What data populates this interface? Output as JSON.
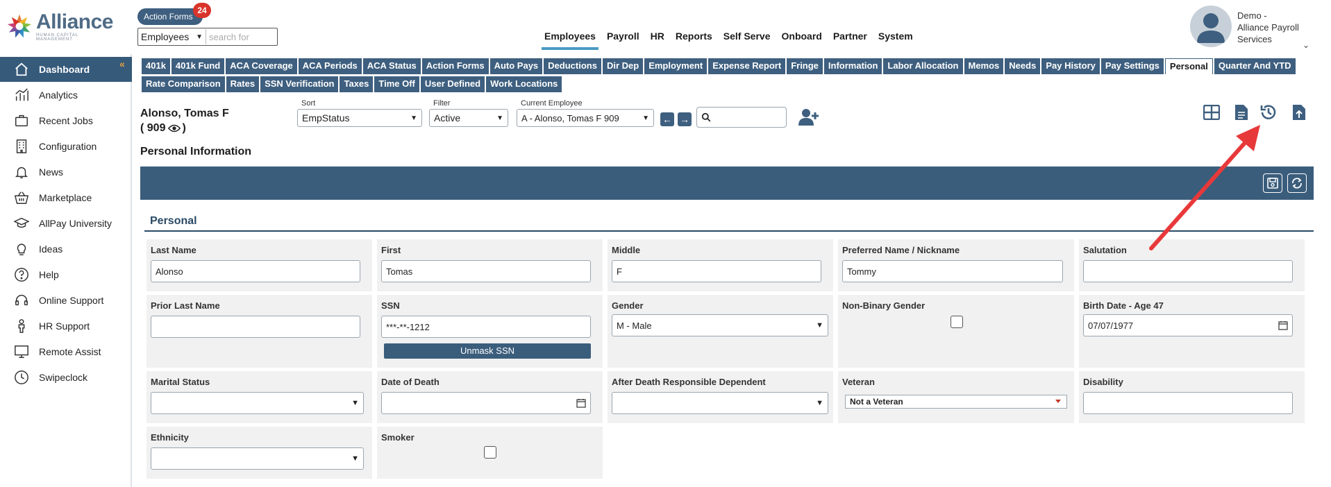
{
  "logo": {
    "name": "Alliance",
    "subtitle": "HUMAN CAPITAL MANAGEMENT"
  },
  "header": {
    "action_forms_label": "Action Forms",
    "action_forms_count": "24",
    "search_scope": "Employees",
    "search_placeholder": "search for",
    "nav": [
      "Employees",
      "Payroll",
      "HR",
      "Reports",
      "Self Serve",
      "Onboard",
      "Partner",
      "System"
    ],
    "active_nav": "Employees",
    "user_line1": "Demo -",
    "user_line2": "Alliance Payroll",
    "user_line3": "Services"
  },
  "sidebar": {
    "items": [
      {
        "label": "Dashboard",
        "icon": "home-icon",
        "active": true
      },
      {
        "label": "Analytics",
        "icon": "analytics-icon"
      },
      {
        "label": "Recent Jobs",
        "icon": "briefcase-icon"
      },
      {
        "label": "Configuration",
        "icon": "building-icon"
      },
      {
        "label": "News",
        "icon": "bell-icon"
      },
      {
        "label": "Marketplace",
        "icon": "basket-icon"
      },
      {
        "label": "AllPay University",
        "icon": "graduation-cap-icon"
      },
      {
        "label": "Ideas",
        "icon": "lightbulb-icon"
      },
      {
        "label": "Help",
        "icon": "question-icon"
      },
      {
        "label": "Online Support",
        "icon": "headset-icon"
      },
      {
        "label": "HR Support",
        "icon": "person-icon"
      },
      {
        "label": "Remote Assist",
        "icon": "monitor-icon"
      },
      {
        "label": "Swipeclock",
        "icon": "clock-icon"
      }
    ]
  },
  "tabs": {
    "row1": [
      "401k",
      "401k Fund",
      "ACA Coverage",
      "ACA Periods",
      "ACA Status",
      "Action Forms",
      "Auto Pays",
      "Deductions",
      "Dir Dep",
      "Employment",
      "Expense Report",
      "Fringe",
      "Information",
      "Labor Allocation",
      "Memos",
      "Needs",
      "Pay History",
      "Pay Settings",
      "Personal",
      "Quarter And YTD"
    ],
    "row2": [
      "Rate Comparison",
      "Rates",
      "SSN Verification",
      "Taxes",
      "Time Off",
      "User Defined",
      "Work Locations"
    ],
    "active": "Personal"
  },
  "employee": {
    "name": "Alonso, Tomas F",
    "id_text": "( 909",
    "id_close": ")",
    "sort_label": "Sort",
    "sort_value": "EmpStatus",
    "filter_label": "Filter",
    "filter_value": "Active",
    "current_label": "Current Employee",
    "current_value": "A - Alonso, Tomas F 909"
  },
  "page": {
    "section_title": "Personal Information",
    "group_title": "Personal"
  },
  "form": {
    "last_name_label": "Last Name",
    "last_name": "Alonso",
    "first_label": "First",
    "first": "Tomas",
    "middle_label": "Middle",
    "middle": "F",
    "preferred_label": "Preferred Name / Nickname",
    "preferred": "Tommy",
    "salutation_label": "Salutation",
    "salutation": "",
    "prior_last_label": "Prior Last Name",
    "prior_last": "",
    "ssn_label": "SSN",
    "ssn": "***-**-1212",
    "unmask_label": "Unmask SSN",
    "gender_label": "Gender",
    "gender": "M - Male",
    "nonbinary_label": "Non-Binary Gender",
    "birth_label": "Birth Date - Age 47",
    "birth": "07/07/1977",
    "marital_label": "Marital Status",
    "marital": "",
    "death_label": "Date of Death",
    "death": "",
    "after_death_label": "After Death Responsible Dependent",
    "after_death": "",
    "veteran_label": "Veteran",
    "veteran": "Not a Veteran",
    "disability_label": "Disability",
    "disability": "",
    "ethnicity_label": "Ethnicity",
    "ethnicity": "",
    "smoker_label": "Smoker"
  },
  "colors": {
    "primary": "#3e5f7f",
    "accent": "#4b9ac2",
    "badge": "#d9342b",
    "annotation": "#e8393a"
  }
}
